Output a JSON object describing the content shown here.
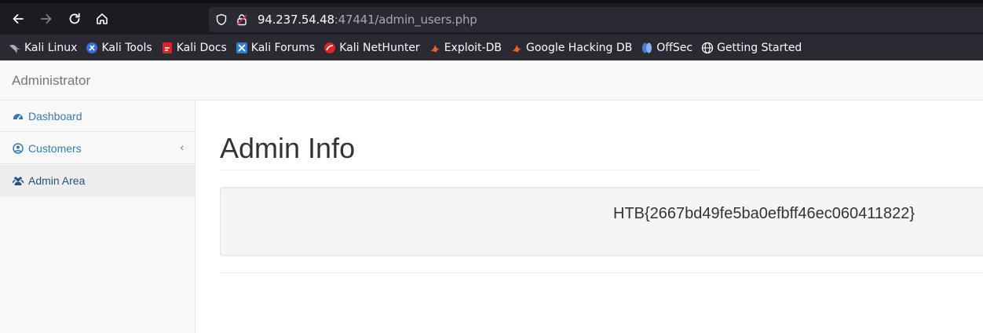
{
  "browser": {
    "url_host": "94.237.54.48",
    "url_rest": ":47441/admin_users.php",
    "nav": {
      "back": "back-arrow-icon",
      "forward": "forward-arrow-icon",
      "reload": "reload-icon",
      "home": "home-icon"
    },
    "bookmarks": [
      {
        "label": "Kali Linux",
        "icon": "kali-dragon-icon",
        "color": "#9aa0a6"
      },
      {
        "label": "Kali Tools",
        "icon": "kali-tools-icon",
        "color": "#3b6fd4"
      },
      {
        "label": "Kali Docs",
        "icon": "kali-docs-icon",
        "color": "#d9262b"
      },
      {
        "label": "Kali Forums",
        "icon": "kali-forums-icon",
        "color": "#2a7fd5"
      },
      {
        "label": "Kali NetHunter",
        "icon": "nethunter-icon",
        "color": "#d9262b"
      },
      {
        "label": "Exploit-DB",
        "icon": "exploit-db-icon",
        "color": "#e8622c"
      },
      {
        "label": "Google Hacking DB",
        "icon": "ghdb-icon",
        "color": "#e8622c"
      },
      {
        "label": "OffSec",
        "icon": "offsec-icon",
        "color": "#4b7bd9"
      },
      {
        "label": "Getting Started",
        "icon": "globe-icon",
        "color": "#fbfbfe"
      }
    ]
  },
  "app": {
    "brand": "Administrator",
    "sidebar": [
      {
        "label": "Dashboard",
        "icon": "dashboard-icon"
      },
      {
        "label": "Customers",
        "icon": "user-circle-icon",
        "caret": "‹"
      },
      {
        "label": "Admin Area",
        "icon": "users-icon"
      }
    ],
    "main": {
      "title": "Admin Info",
      "flag": "HTB{2667bd49fe5ba0efbff46ec060411822}"
    }
  },
  "colors": {
    "link": "#337ab7",
    "active_link": "#23527c",
    "toolbar_bg": "#1c1b22",
    "urlbar_bg": "#2b2a33"
  }
}
